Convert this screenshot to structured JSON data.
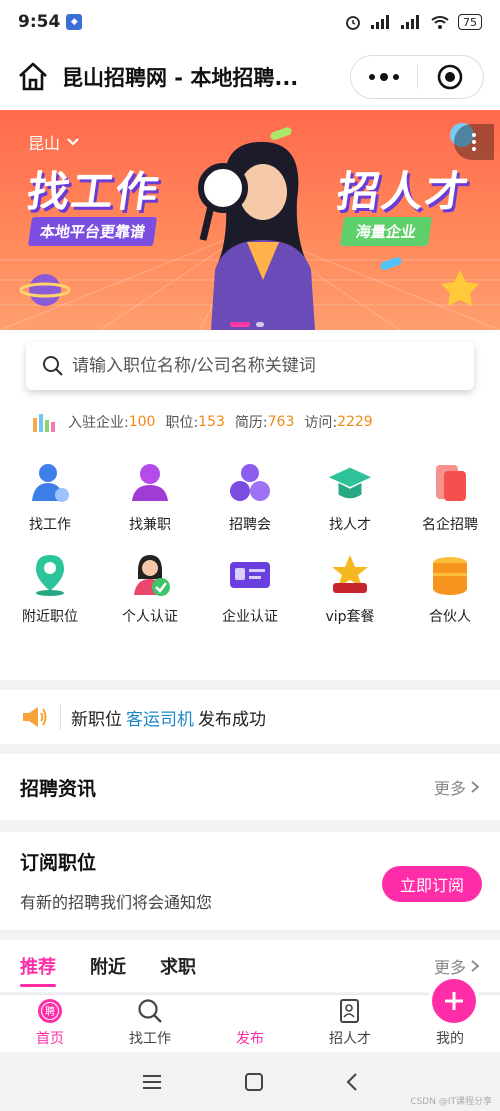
{
  "status_bar": {
    "time": "9:54",
    "battery": "75"
  },
  "titlebar": {
    "title": "昆山招聘网 - 本地招聘..."
  },
  "banner": {
    "city": "昆山",
    "headline_left": "找工作",
    "tagline_left": "本地平台更靠谱",
    "headline_right": "招人才",
    "tagline_right": "海量企业"
  },
  "search": {
    "placeholder": "请输入职位名称/公司名称关键词"
  },
  "stats": [
    {
      "label": "入驻企业:",
      "value": "100"
    },
    {
      "label": "职位:",
      "value": "153"
    },
    {
      "label": "简历:",
      "value": "763"
    },
    {
      "label": "访问:",
      "value": "2229"
    }
  ],
  "menu": [
    {
      "label": "找工作",
      "icon": "job-seeker-icon"
    },
    {
      "label": "找兼职",
      "icon": "part-time-icon"
    },
    {
      "label": "招聘会",
      "icon": "job-fair-icon"
    },
    {
      "label": "找人才",
      "icon": "talent-icon"
    },
    {
      "label": "名企招聘",
      "icon": "famous-company-icon"
    },
    {
      "label": "附近职位",
      "icon": "nearby-location-icon"
    },
    {
      "label": "个人认证",
      "icon": "personal-verify-icon"
    },
    {
      "label": "企业认证",
      "icon": "company-verify-icon"
    },
    {
      "label": "vip套餐",
      "icon": "vip-crown-icon"
    },
    {
      "label": "合伙人",
      "icon": "partner-icon"
    }
  ],
  "notice": {
    "prefix": "新职位",
    "highlight": "客运司机",
    "suffix": "发布成功"
  },
  "news": {
    "title": "招聘资讯",
    "more": "更多"
  },
  "subscribe": {
    "title": "订阅职位",
    "desc": "有新的招聘我们将会通知您",
    "button": "立即订阅"
  },
  "tabs": {
    "items": [
      "推荐",
      "附近",
      "求职"
    ],
    "more": "更多"
  },
  "bottom_nav": [
    {
      "label": "首页"
    },
    {
      "label": "找工作"
    },
    {
      "label": "发布"
    },
    {
      "label": "招人才"
    },
    {
      "label": "我的"
    }
  ],
  "home_badge": "聘",
  "watermark": "CSDN @IT课程分享",
  "colors": {
    "accent": "#ff2ea8",
    "stat_value": "#f0891a",
    "link": "#1e88c9"
  }
}
